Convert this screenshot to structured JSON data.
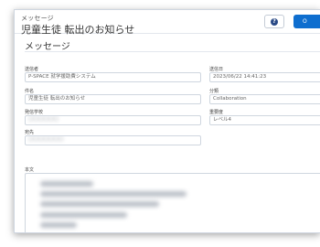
{
  "header": {
    "subtitle": "メッセージ",
    "title": "児童生徒 転出のお知らせ",
    "help_icon": "question-icon",
    "primary_button_label": "O"
  },
  "section": {
    "title": "メッセージ"
  },
  "fields": {
    "sender": {
      "label": "送信者",
      "value": "P-SPACE 就学援助費システム"
    },
    "sent_date": {
      "label": "送信日",
      "value": "2023/06/22 14:41:23"
    },
    "subject": {
      "label": "件名",
      "value": "児童生徒 転出のお知らせ"
    },
    "category": {
      "label": "分類",
      "value": "Collaboration"
    },
    "sender_school": {
      "label": "発信学校",
      "value": "〇〇〇〇〇〇"
    },
    "importance": {
      "label": "重要度",
      "value": "レベル4"
    },
    "recipient": {
      "label": "宛先",
      "value": "〇〇〇〇〇〇〇"
    },
    "body": {
      "label": "本文"
    }
  }
}
